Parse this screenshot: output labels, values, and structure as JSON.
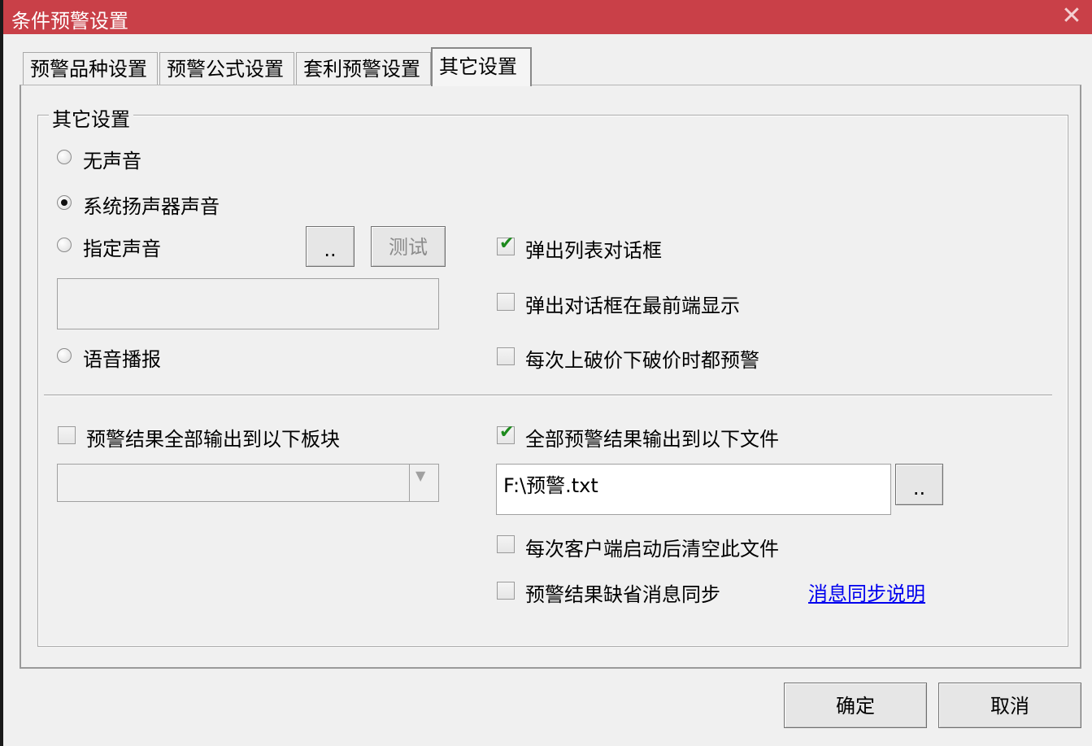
{
  "window": {
    "title": "条件预警设置",
    "close_symbol": "✕"
  },
  "tabs": [
    {
      "label": "预警品种设置",
      "active": false
    },
    {
      "label": "预警公式设置",
      "active": false
    },
    {
      "label": "套利预警设置",
      "active": false
    },
    {
      "label": "其它设置",
      "active": true
    }
  ],
  "group": {
    "title": "其它设置"
  },
  "sound": {
    "none_label": "无声音",
    "system_label": "系统扬声器声音",
    "custom_label": "指定声音",
    "speech_label": "语音播报",
    "selected": "system",
    "browse_label": "..",
    "test_label": "测试",
    "custom_path": ""
  },
  "popup": {
    "list_dialog_label": "弹出列表对话框",
    "list_dialog_checked": true,
    "topmost_label": "弹出对话框在最前端显示",
    "topmost_checked": false,
    "every_break_label": "每次上破价下破价时都预警",
    "every_break_checked": false
  },
  "output_block": {
    "label": "预警结果全部输出到以下板块",
    "checked": false,
    "selected_block": ""
  },
  "output_file": {
    "label": "全部预警结果输出到以下文件",
    "checked": true,
    "path": "F:\\预警.txt",
    "browse_label": "..",
    "clear_on_start_label": "每次客户端启动后清空此文件",
    "clear_on_start_checked": false,
    "default_sync_label": "预警结果缺省消息同步",
    "default_sync_checked": false,
    "sync_help_link": "消息同步说明"
  },
  "footer": {
    "ok_label": "确定",
    "cancel_label": "取消"
  },
  "colors": {
    "titlebar": "#c94048",
    "link": "#0000ee",
    "check": "#1d8a1d"
  }
}
